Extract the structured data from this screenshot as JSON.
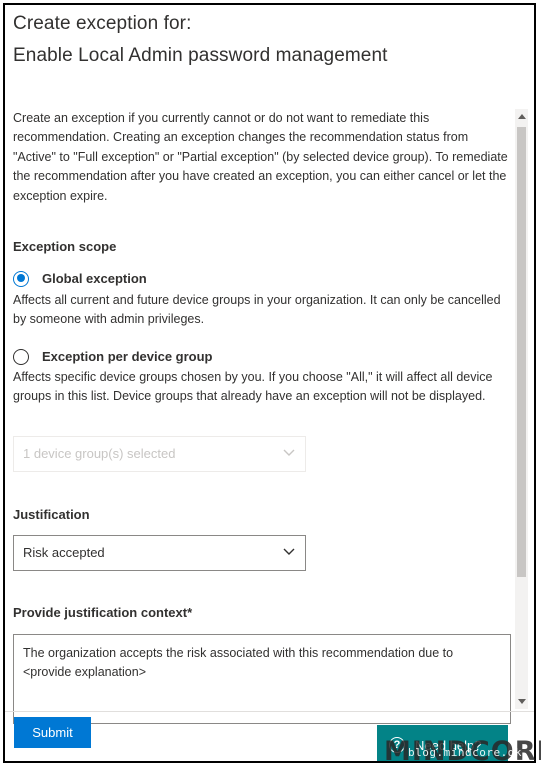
{
  "header": {
    "title_line1": "Create exception for:",
    "title_line2": "Enable Local Admin password management"
  },
  "intro_text": "Create an exception if you currently cannot or do not want to remediate this recommendation. Creating an exception changes the recommendation status from \"Active\" to \"Full exception\" or \"Partial exception\" (by selected device group). To remediate the recommendation after you have created an exception, you can either cancel or let the exception expire.",
  "scope": {
    "label": "Exception scope",
    "options": [
      {
        "label": "Global exception",
        "selected": true,
        "description": "Affects all current and future device groups in your organization. It can only be cancelled by someone with admin privileges."
      },
      {
        "label": "Exception per device group",
        "selected": false,
        "description": "Affects specific device groups chosen by you. If you choose \"All,\" it will affect all device groups in this list. Device groups that already have an exception will not be displayed."
      }
    ],
    "device_group_dropdown": {
      "value": "1 device group(s) selected",
      "disabled": true,
      "icon": "chevron-down-icon"
    }
  },
  "justification": {
    "label": "Justification",
    "value": "Risk accepted",
    "icon": "chevron-down-icon"
  },
  "context": {
    "label": "Provide justification context*",
    "value": "The organization accepts the risk associated with this recommendation due to <provide explanation>"
  },
  "footer": {
    "submit_label": "Submit",
    "help_label": "Need help?",
    "help_icon": "question-circle-icon"
  },
  "watermark": {
    "text": "MINDCORE",
    "subtext": "blog.mindcore.dk"
  },
  "colors": {
    "accent": "#0078d4",
    "help_button": "#038387",
    "text": "#323130"
  }
}
